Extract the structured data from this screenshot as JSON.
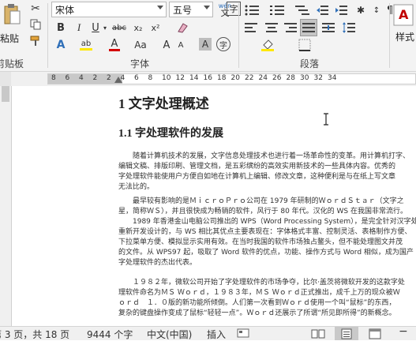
{
  "ribbon": {
    "clipboard": {
      "paste_label": "粘贴",
      "group_label": "剪贴板"
    },
    "font": {
      "font_name": "宋体",
      "font_size": "五号",
      "phonetic_top": "wén",
      "phonetic_char": "文",
      "bold": "B",
      "italic": "I",
      "underline": "U",
      "strike": "abc",
      "subscript": "x₂",
      "superscript": "x²",
      "text_effect": "A",
      "highlight": "ab",
      "font_color": "A",
      "change_case": "Aa",
      "grow": "A",
      "shrink": "A",
      "char_shading": "A",
      "encircle": "字",
      "group_label": "字体"
    },
    "paragraph": {
      "group_label": "段落"
    },
    "styles": {
      "styles_label": "样式"
    }
  },
  "ruler": {
    "numbers": [
      "8",
      "6",
      "4",
      "2",
      "2",
      "4",
      "6",
      "8",
      "10",
      "12",
      "14",
      "16",
      "18",
      "20",
      "22",
      "24",
      "26",
      "28",
      "30",
      "32",
      "34"
    ]
  },
  "document": {
    "heading1": "1 文字处理概述",
    "heading2": "1.1 字处理软件的发展",
    "p1": [
      "随着计算机技术的发展，文字信息处理技术也进行着一场革命性的变革。用计算机打字、",
      "编辑文稿、排版印刷、管理文档，是五彩缤纷的高效实用新技术的一些具体内容。优秀的",
      "字处理软件能使用户方便自如地在计算机上编辑、修改文章，这种便利是与在纸上写文章",
      "无法比的。"
    ],
    "p2": [
      "最早较有影响的是ＭｉｃｒｏＰｒｏ公司在 1979 年研制的ＷｏｒｄＳｔａｒ（文字之",
      "星，简称ＷＳ），并且很快成为畅销的软件，风行于 80 年代。汉化的 WS 在我国非常流行。",
      "1989 年香港金山电脑公司推出的 WPS（Word Processing System），是完全针对汉字处理",
      "重新开发设计的，与 WS 相比其优点主要表现在：字体格式丰富、控制灵活、表格制作方便、",
      "下拉菜单方便、模拟显示实用有效。在当时我国的软件市场独占鳌头，但不能处理图文并茂",
      "的文件。从 WPS97 起，吸取了 Word 软件的优点，功能、操作方式与 Word 相似，成为国产",
      "字处理软件的杰出代表。"
    ],
    "p3": [
      "１９８２年，微软公司开始了字处理软件的市场争夺，比尔·盖茨将微软开发的这款字处",
      "理软件命名为ＭＳ Ｗｏｒｄ，１９８３年，ＭＳ Ｗｏｒｄ正式推出，成千上万的现众被Ｗ",
      "ｏｒｄ　１．０版的新功能所倾倒。人们第一次看到Ｗｏｒｄ使用一个叫“鼠标”的东西，",
      "复杂的键盘操作变成了鼠标“轻轻一点”。Ｗｏｒｄ还展示了所谓“所见即所得”的新概念。"
    ]
  },
  "status": {
    "page": "第 3 页，共 18 页",
    "words": "9444 个字",
    "language": "中文(中国)",
    "insert": "插入"
  },
  "colors": {
    "ribbon_bg": "#f3f3f3",
    "font_color_red": "#d40000",
    "highlight_yellow": "#ffe800",
    "style_a_red": "#c00000",
    "effect_blue": "#2f6fb8"
  }
}
